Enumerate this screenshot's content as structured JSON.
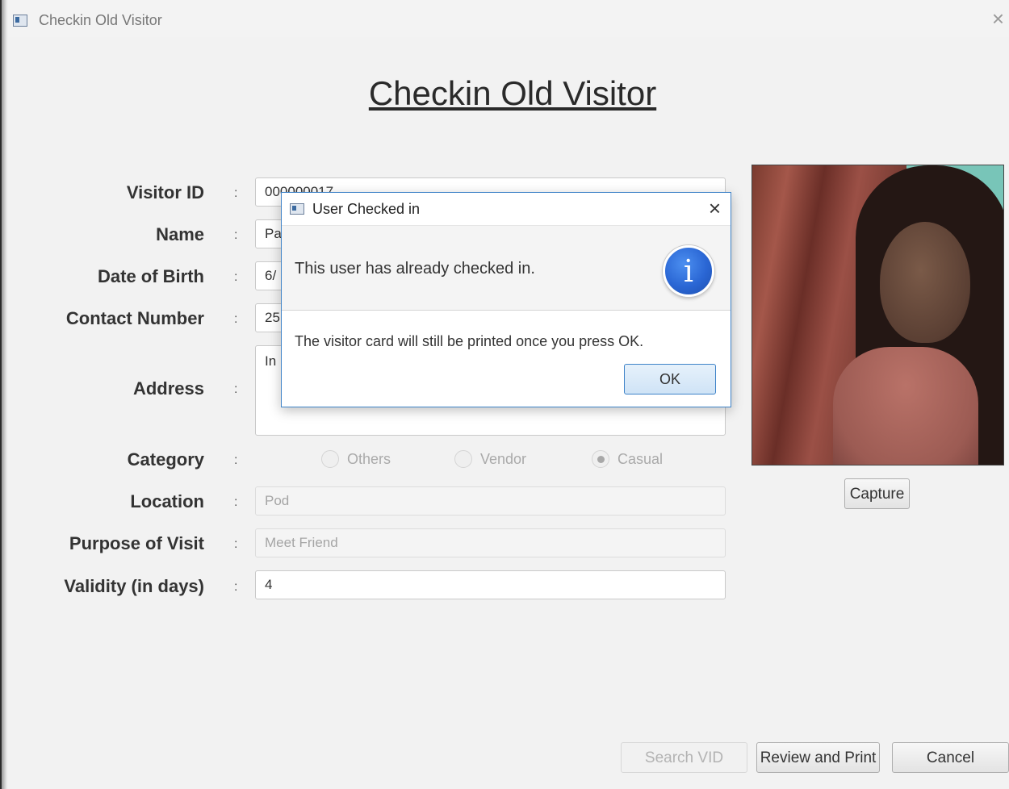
{
  "window": {
    "title": "Checkin Old Visitor"
  },
  "heading": "Checkin Old Visitor",
  "form": {
    "colon": ":",
    "labels": {
      "visitor_id": "Visitor ID",
      "name": "Name",
      "dob": "Date of Birth",
      "contact": "Contact Number",
      "address": "Address",
      "category": "Category",
      "location": "Location",
      "purpose": "Purpose of Visit",
      "validity": "Validity (in days)"
    },
    "values": {
      "visitor_id": "000000017",
      "name": "Pa",
      "dob": "6/",
      "contact": "25",
      "address": "In",
      "location": "Pod",
      "purpose": "Meet Friend",
      "validity": "4"
    },
    "category_options": [
      {
        "label": "Others",
        "selected": false
      },
      {
        "label": "Vendor",
        "selected": false
      },
      {
        "label": "Casual",
        "selected": true
      }
    ]
  },
  "buttons": {
    "capture": "Capture",
    "search": "Search VID",
    "review": "Review and Print",
    "cancel": "Cancel"
  },
  "dialog": {
    "title": "User Checked in",
    "header": "This user has already checked in.",
    "content": "The visitor card will still be printed once you press OK.",
    "ok": "OK",
    "icon_glyph": "i"
  },
  "icons": {
    "close": "×",
    "info": "info-icon"
  }
}
